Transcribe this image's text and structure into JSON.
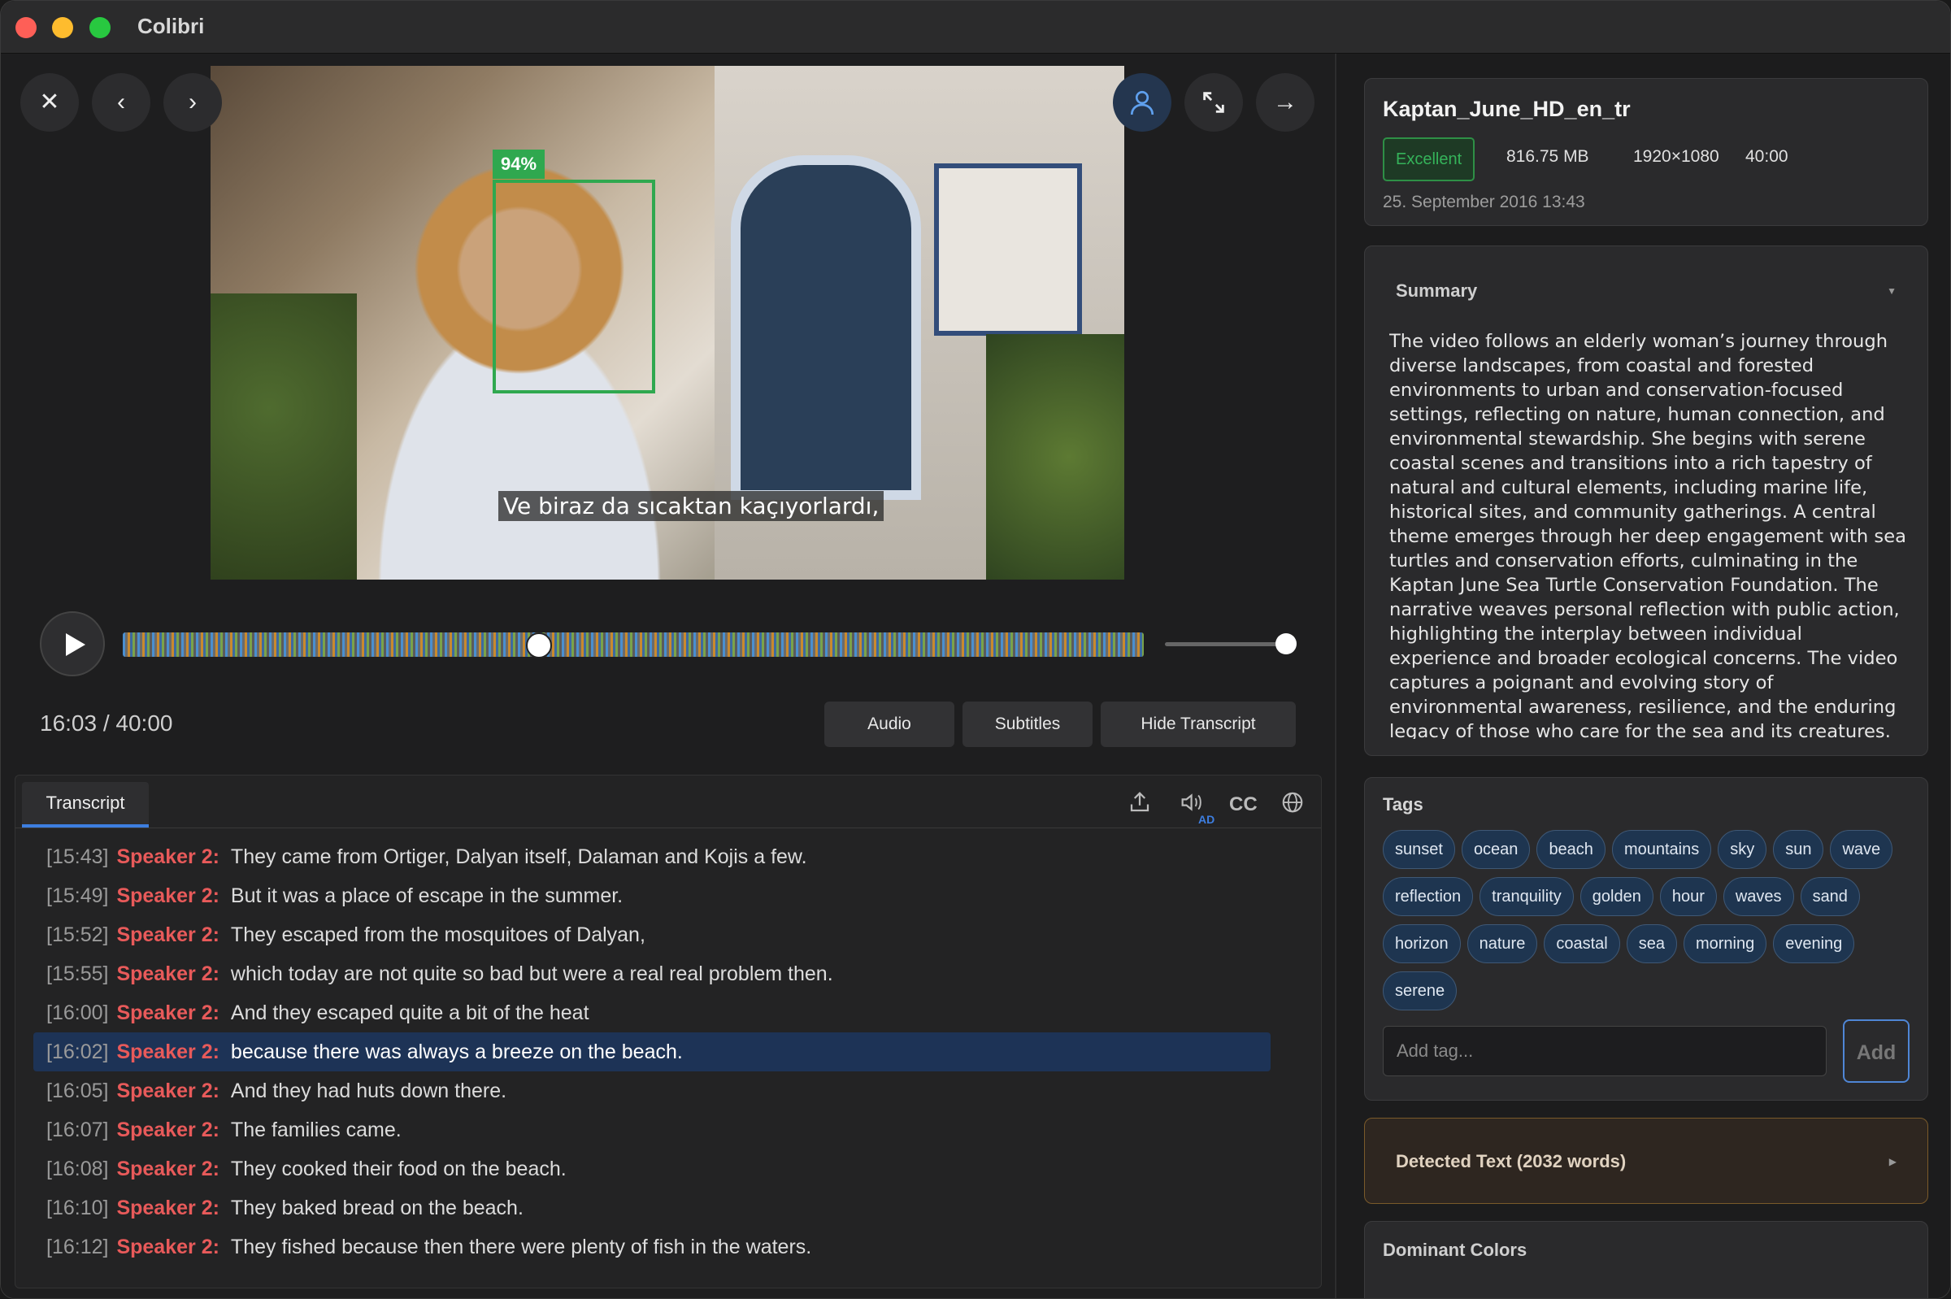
{
  "app": {
    "title": "Colibri"
  },
  "video": {
    "face_confidence": "94%",
    "subtitle": "Ve biraz da sıcaktan kaçıyorlardı,"
  },
  "player": {
    "current_time": "16:03 / 40:00",
    "progress_fraction": 0.4,
    "volume_fraction": 1.0,
    "buttons": {
      "audio": "Audio",
      "subtitles": "Subtitles",
      "hide_transcript": "Hide Transcript"
    }
  },
  "nav_icons": [
    "close-icon",
    "chevron-left-icon",
    "chevron-right-icon",
    "person-icon",
    "expand-icon",
    "arrow-right-icon"
  ],
  "transcript": {
    "tab": "Transcript",
    "cc_label": "CC",
    "ad_label": "AD",
    "rows": [
      {
        "ts": "[15:43]",
        "speaker": "Speaker 2:",
        "text": "They came from Ortiger, Dalyan itself, Dalaman and Kojis a few."
      },
      {
        "ts": "[15:49]",
        "speaker": "Speaker 2:",
        "text": "But it was a place of escape in the summer."
      },
      {
        "ts": "[15:52]",
        "speaker": "Speaker 2:",
        "text": "They escaped from the mosquitoes of Dalyan,"
      },
      {
        "ts": "[15:55]",
        "speaker": "Speaker 2:",
        "text": "which today are not quite so bad but were a real real problem then."
      },
      {
        "ts": "[16:00]",
        "speaker": "Speaker 2:",
        "text": "And they escaped quite a bit of the heat"
      },
      {
        "ts": "[16:02]",
        "speaker": "Speaker 2:",
        "text": "because there was always a breeze on the beach.",
        "active": true
      },
      {
        "ts": "[16:05]",
        "speaker": "Speaker 2:",
        "text": "And they had huts down there."
      },
      {
        "ts": "[16:07]",
        "speaker": "Speaker 2:",
        "text": "The families came."
      },
      {
        "ts": "[16:08]",
        "speaker": "Speaker 2:",
        "text": "They cooked their food on the beach."
      },
      {
        "ts": "[16:10]",
        "speaker": "Speaker 2:",
        "text": "They baked bread on the beach."
      },
      {
        "ts": "[16:12]",
        "speaker": "Speaker 2:",
        "text": "They fished because then there were plenty of fish in the waters."
      }
    ]
  },
  "file": {
    "name": "Kaptan_June_HD_en_tr",
    "quality": "Excellent",
    "size": "816.75 MB",
    "resolution": "1920×1080",
    "duration": "40:00",
    "date": "25. September 2016 13:43"
  },
  "summary": {
    "heading": "Summary",
    "text": "The video follows an elderly woman’s journey through diverse landscapes, from coastal and forested environments to urban and conservation-focused settings, reflecting on nature, human connection, and environmental stewardship. She begins with serene coastal scenes and transitions into a rich tapestry of natural and cultural elements, including marine life, historical sites, and community gatherings. A central theme emerges through her deep engagement with sea turtles and conservation efforts, culminating in the Kaptan June Sea Turtle Conservation Foundation. The narrative weaves personal reflection with public action, highlighting the interplay between individual experience and broader ecological concerns. The video captures a poignant and evolving story of environmental awareness, resilience, and the enduring legacy of those who care for the sea and its creatures."
  },
  "tags": {
    "heading": "Tags",
    "items": [
      "sunset",
      "ocean",
      "beach",
      "mountains",
      "sky",
      "sun",
      "wave",
      "reflection",
      "tranquility",
      "golden",
      "hour",
      "waves",
      "sand",
      "horizon",
      "nature",
      "coastal",
      "sea",
      "morning",
      "evening",
      "serene"
    ],
    "input_placeholder": "Add tag...",
    "add_label": "Add"
  },
  "detected_text": {
    "heading": "Detected Text (2032 words)"
  },
  "dominant_colors": {
    "heading": "Dominant Colors"
  }
}
